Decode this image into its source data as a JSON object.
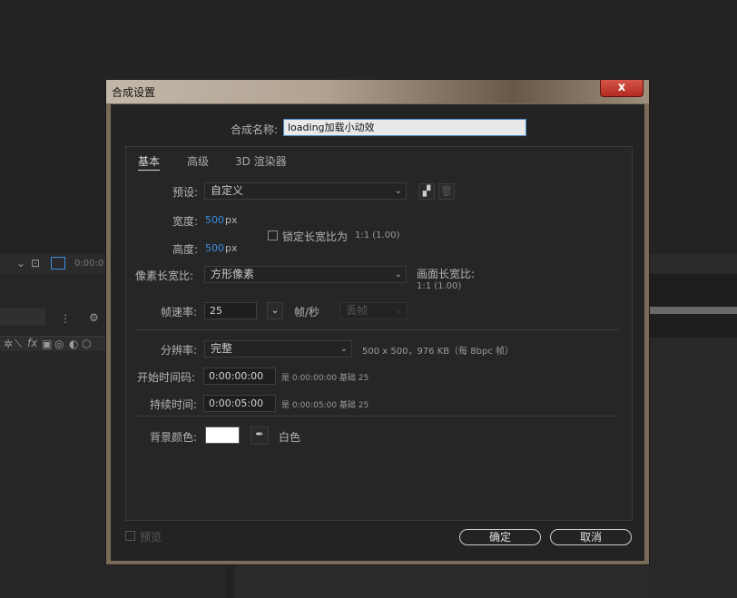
{
  "background": {
    "strip_timecode": "0:00:0"
  },
  "dialog": {
    "title": "合成设置",
    "close_glyph": "x",
    "name_label": "合成名称:",
    "name_value": "loading加载小动效",
    "tabs": [
      "基本",
      "高级",
      "3D 渲染器"
    ],
    "preset": {
      "label": "预设:",
      "value": "自定义"
    },
    "width": {
      "label": "宽度:",
      "value": "500",
      "unit": "px"
    },
    "height": {
      "label": "高度:",
      "value": "500",
      "unit": "px"
    },
    "lock_aspect": {
      "label": "锁定长宽比为",
      "ratio": "1:1 (1.00)",
      "checked": false
    },
    "pixel_aspect": {
      "label": "像素长宽比:",
      "value": "方形像素"
    },
    "frame_aspect": {
      "label": "画面长宽比:",
      "value": "1:1 (1.00)"
    },
    "frame_rate": {
      "label": "帧速率:",
      "value": "25",
      "unit": "帧/秒",
      "drop_frame": "丢帧"
    },
    "resolution": {
      "label": "分辨率:",
      "value": "完整",
      "info": "500 x 500，976 KB（每 8bpc 帧）"
    },
    "start_timecode": {
      "label": "开始时间码:",
      "value": "0:00:00:00",
      "note": "是 0:00:00:00 基础 25"
    },
    "duration": {
      "label": "持续时间:",
      "value": "0:00:05:00",
      "note": "是 0:00:05:00 基础 25"
    },
    "bg_color": {
      "label": "背景颜色:",
      "color": "#ffffff",
      "name": "白色"
    },
    "preview_label": "预览",
    "ok_label": "确定",
    "cancel_label": "取消"
  },
  "colors": {
    "accent_blue": "#3d8fe0",
    "title_bar": "#b1a392",
    "close_red": "#c2392e"
  },
  "icons": [
    "new-preset-icon",
    "delete-preset-icon",
    "eyedropper-icon",
    "chevron-down-icon",
    "close-icon"
  ]
}
